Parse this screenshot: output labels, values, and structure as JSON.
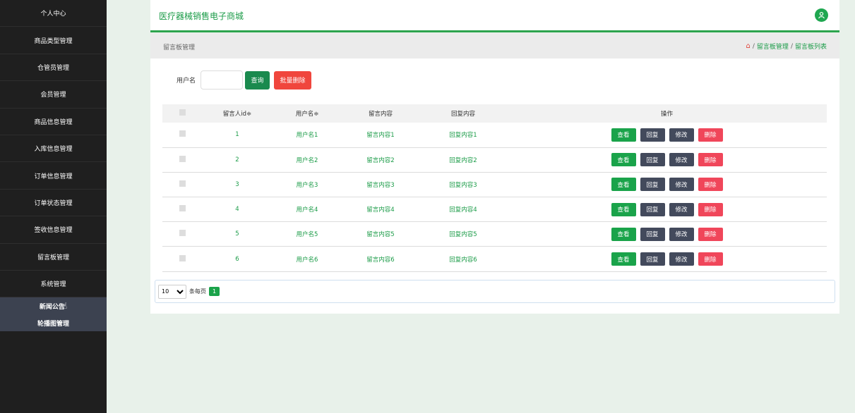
{
  "sidebar": {
    "items": [
      {
        "label": "个人中心"
      },
      {
        "label": "商品类型管理"
      },
      {
        "label": "仓管员管理"
      },
      {
        "label": "会员管理"
      },
      {
        "label": "商品信息管理"
      },
      {
        "label": "入库信息管理"
      },
      {
        "label": "订单信息管理"
      },
      {
        "label": "订单状态管理"
      },
      {
        "label": "签收信息管理"
      },
      {
        "label": "留言板管理"
      },
      {
        "label": "系统管理"
      }
    ],
    "sub_items": [
      {
        "label": "新闻公告"
      },
      {
        "label": "轮播图管理"
      }
    ]
  },
  "header": {
    "title": "医疗器械销售电子商城",
    "user_icon": "user-icon"
  },
  "breadcrumb": {
    "title": "留言板管理",
    "links": [
      "留言板管理",
      "留言板列表"
    ],
    "separator": "/"
  },
  "search": {
    "label": "用户名",
    "value": "",
    "placeholder": "",
    "query_label": "查询",
    "batch_delete_label": "批量删除"
  },
  "table": {
    "headers": [
      "留言人id≑",
      "用户名≑",
      "留言内容",
      "回复内容",
      "操作"
    ],
    "actions": {
      "view": "查看",
      "reply": "回复",
      "edit": "修改",
      "delete": "删除"
    },
    "rows": [
      {
        "id": "1",
        "username": "用户名1",
        "message": "留言内容1",
        "reply": "回复内容1"
      },
      {
        "id": "2",
        "username": "用户名2",
        "message": "留言内容2",
        "reply": "回复内容2"
      },
      {
        "id": "3",
        "username": "用户名3",
        "message": "留言内容3",
        "reply": "回复内容3"
      },
      {
        "id": "4",
        "username": "用户名4",
        "message": "留言内容4",
        "reply": "回复内容4"
      },
      {
        "id": "5",
        "username": "用户名5",
        "message": "留言内容5",
        "reply": "回复内容5"
      },
      {
        "id": "6",
        "username": "用户名6",
        "message": "留言内容6",
        "reply": "回复内容6"
      }
    ]
  },
  "pager": {
    "page_size": "10",
    "page_size_label": "条每页",
    "current_page": "1"
  },
  "colors": {
    "accent": "#1a9b47",
    "sidebar_bg": "#1f1f1f",
    "danger": "#f0465a",
    "secondary": "#434a5c"
  }
}
